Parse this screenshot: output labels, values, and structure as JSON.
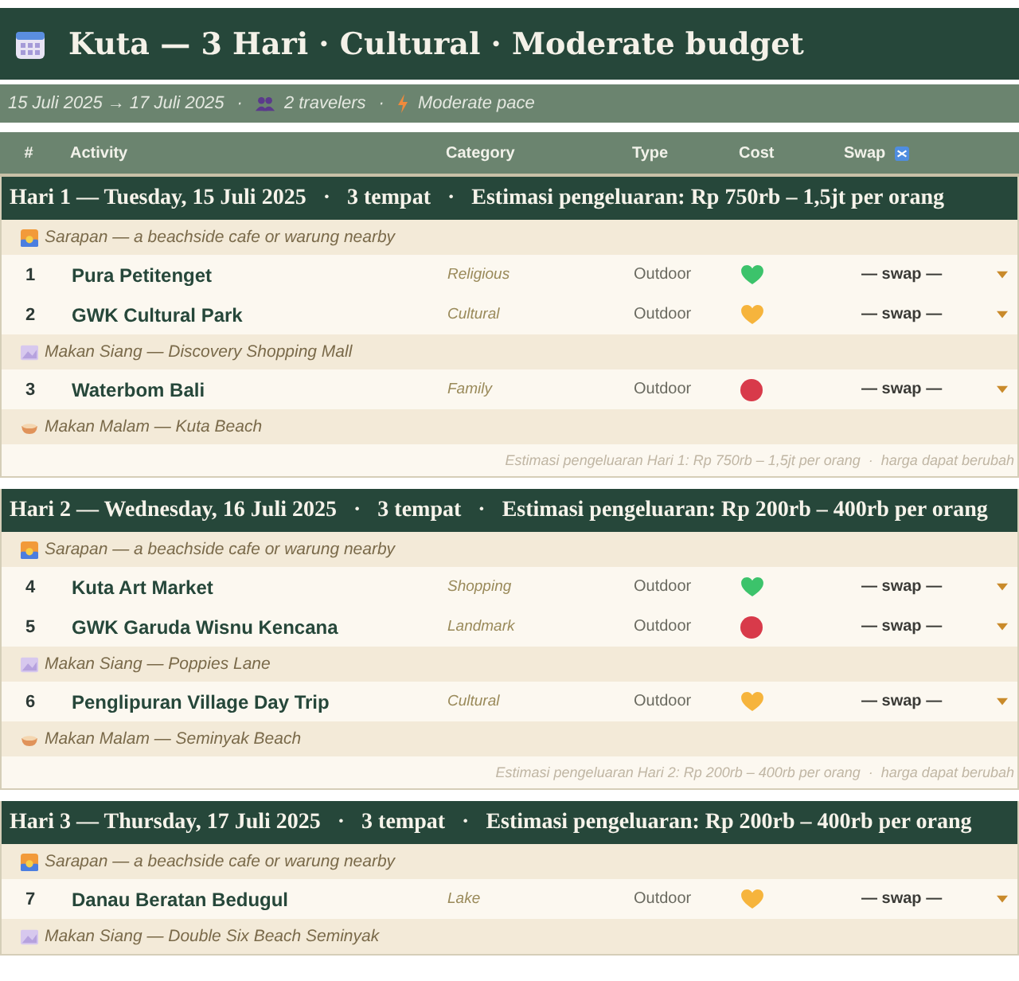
{
  "title": "Kuta — 3 Hari · Cultural · Moderate budget",
  "meta": {
    "dates": "15 Juli 2025 → 17 Juli 2025",
    "travelers": "2 travelers",
    "pace": "Moderate pace",
    "separator": "·"
  },
  "columns": [
    "#",
    "Activity",
    "Category",
    "Type",
    "Cost",
    "Swap"
  ],
  "days": [
    {
      "header": "Hari 1 — Tuesday, 15 Juli 2025   ·   3 tempat   ·   Estimasi pengeluaran: Rp 750rb – 1,5jt per orang",
      "rows": [
        {
          "kind": "meal",
          "icon": {
            "kind": "breakfast"
          },
          "text": "Sarapan — a beachside cafe or warung nearby"
        },
        {
          "kind": "activity",
          "num": "1",
          "name": "Pura Petitenget",
          "category": "Religious",
          "type": "Outdoor",
          "cost": {
            "kind": "heart",
            "color": "#3cc36b"
          },
          "swap": "— swap —"
        },
        {
          "kind": "activity",
          "num": "2",
          "name": "GWK Cultural Park",
          "category": "Cultural",
          "type": "Outdoor",
          "cost": {
            "kind": "heart",
            "color": "#f6b43c"
          },
          "swap": "— swap —"
        },
        {
          "kind": "meal",
          "icon": {
            "kind": "lunch"
          },
          "text": "Makan Siang — Discovery Shopping Mall"
        },
        {
          "kind": "activity",
          "num": "3",
          "name": "Waterbom Bali",
          "category": "Family",
          "type": "Outdoor",
          "cost": {
            "kind": "dot",
            "color": "#d83a4a"
          },
          "swap": "— swap —"
        },
        {
          "kind": "meal",
          "icon": {
            "kind": "dinner"
          },
          "text": "Makan Malam — Kuta Beach"
        }
      ],
      "footer": "Estimasi pengeluaran Hari 1: Rp 750rb – 1,5jt per orang  ·  harga dapat berubah"
    },
    {
      "header": "Hari 2 — Wednesday, 16 Juli 2025   ·   3 tempat   ·   Estimasi pengeluaran: Rp 200rb – 400rb per orang",
      "rows": [
        {
          "kind": "meal",
          "icon": {
            "kind": "breakfast"
          },
          "text": "Sarapan — a beachside cafe or warung nearby"
        },
        {
          "kind": "activity",
          "num": "4",
          "name": "Kuta Art Market",
          "category": "Shopping",
          "type": "Outdoor",
          "cost": {
            "kind": "heart",
            "color": "#3cc36b"
          },
          "swap": "— swap —"
        },
        {
          "kind": "activity",
          "num": "5",
          "name": "GWK Garuda Wisnu Kencana",
          "category": "Landmark",
          "type": "Outdoor",
          "cost": {
            "kind": "dot",
            "color": "#d83a4a"
          },
          "swap": "— swap —"
        },
        {
          "kind": "meal",
          "icon": {
            "kind": "lunch"
          },
          "text": "Makan Siang — Poppies Lane"
        },
        {
          "kind": "activity",
          "num": "6",
          "name": "Penglipuran Village Day Trip",
          "category": "Cultural",
          "type": "Outdoor",
          "cost": {
            "kind": "heart",
            "color": "#f6b43c"
          },
          "swap": "— swap —"
        },
        {
          "kind": "meal",
          "icon": {
            "kind": "dinner"
          },
          "text": "Makan Malam — Seminyak Beach"
        }
      ],
      "footer": "Estimasi pengeluaran Hari 2: Rp 200rb – 400rb per orang  ·  harga dapat berubah"
    },
    {
      "header": "Hari 3 — Thursday, 17 Juli 2025   ·   3 tempat   ·   Estimasi pengeluaran: Rp 200rb – 400rb per orang",
      "rows": [
        {
          "kind": "meal",
          "icon": {
            "kind": "breakfast"
          },
          "text": "Sarapan — a beachside cafe or warung nearby"
        },
        {
          "kind": "activity",
          "num": "7",
          "name": "Danau Beratan Bedugul",
          "category": "Lake",
          "type": "Outdoor",
          "cost": {
            "kind": "heart",
            "color": "#f6b43c"
          },
          "swap": "— swap —"
        },
        {
          "kind": "meal",
          "icon": {
            "kind": "lunch"
          },
          "text": "Makan Siang — Double Six Beach Seminyak"
        }
      ]
    }
  ]
}
